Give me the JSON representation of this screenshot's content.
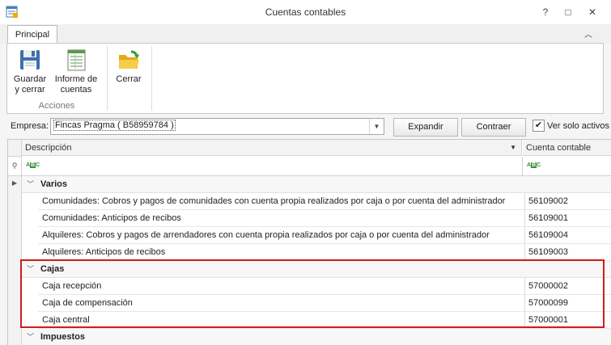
{
  "window": {
    "title": "Cuentas contables",
    "controls": [
      "?",
      "□",
      "✕"
    ]
  },
  "ribbon": {
    "tab": "Principal",
    "buttons": [
      {
        "line1": "Guardar",
        "line2": "y cerrar"
      },
      {
        "line1": "Informe de",
        "line2": "cuentas"
      },
      {
        "line1": "Cerrar",
        "line2": ""
      }
    ],
    "group_label": "Acciones"
  },
  "toolbar": {
    "empresa_label": "Empresa:",
    "empresa_value": "Fincas Pragma ( B58959784 )",
    "expandir": "Expandir",
    "contraer": "Contraer",
    "solo_activos_checked": true,
    "solo_activos_label": "Ver solo activos"
  },
  "grid": {
    "col_descripcion": "Descripción",
    "col_cuenta": "Cuenta contable",
    "groups": [
      {
        "name": "Varios",
        "rows": [
          {
            "desc": "Comunidades: Cobros y pagos de comunidades con cuenta propia realizados por caja o por cuenta del administrador",
            "cuenta": "56109002"
          },
          {
            "desc": "Comunidades: Anticipos de recibos",
            "cuenta": "56109001"
          },
          {
            "desc": "Alquileres: Cobros y pagos de arrendadores con cuenta propia realizados por caja o por cuenta del administrador",
            "cuenta": "56109004"
          },
          {
            "desc": "Alquileres: Anticipos de recibos",
            "cuenta": "56109003"
          }
        ]
      },
      {
        "name": "Cajas",
        "rows": [
          {
            "desc": "Caja recepción",
            "cuenta": "57000002"
          },
          {
            "desc": "Caja de compensación",
            "cuenta": "57000099"
          },
          {
            "desc": "Caja central",
            "cuenta": "57000001"
          }
        ]
      },
      {
        "name": "Impuestos",
        "rows": []
      }
    ]
  },
  "colors": {
    "highlight": "#d11b1b",
    "accent_green": "#3a8f3a"
  }
}
